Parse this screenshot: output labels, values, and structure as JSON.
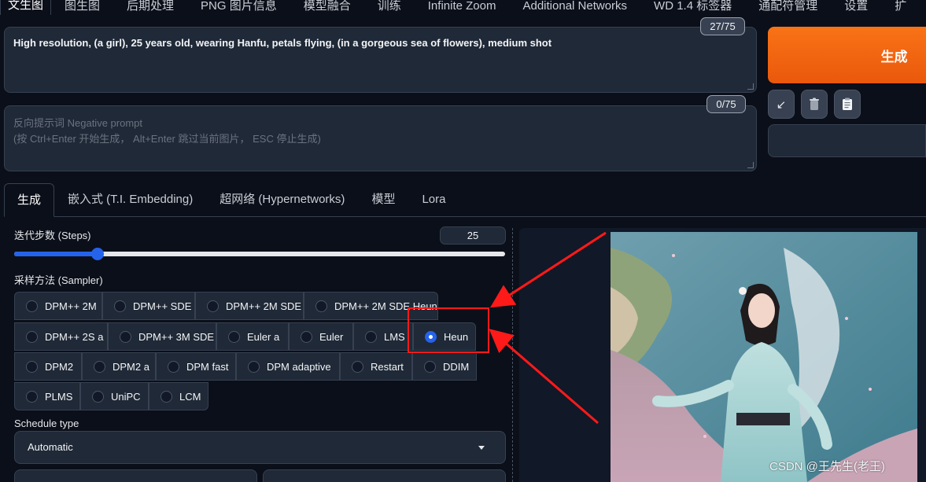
{
  "top_tabs": [
    {
      "label": "文生图",
      "active": true
    },
    {
      "label": "图生图"
    },
    {
      "label": "后期处理"
    },
    {
      "label": "PNG 图片信息"
    },
    {
      "label": "模型融合"
    },
    {
      "label": "训练"
    },
    {
      "label": "Infinite Zoom"
    },
    {
      "label": "Additional Networks"
    },
    {
      "label": "WD 1.4 标签器"
    },
    {
      "label": "通配符管理"
    },
    {
      "label": "设置"
    },
    {
      "label": "扩"
    }
  ],
  "prompt": {
    "text": "High resolution, (a girl), 25 years old, wearing Hanfu, petals flying, (in a gorgeous sea of flowers), medium shot",
    "counter": "27/75"
  },
  "negative": {
    "placeholder_line1": "反向提示词 Negative prompt",
    "placeholder_line2": "(按 Ctrl+Enter 开始生成， Alt+Enter 跳过当前图片， ESC 停止生成)",
    "counter": "0/75"
  },
  "generate_label": "生成",
  "tools": {
    "apply_icon": "↙",
    "trash_icon": "🗑",
    "clipboard_icon": "📋"
  },
  "sub_tabs": [
    {
      "label": "生成",
      "active": true
    },
    {
      "label": "嵌入式 (T.I. Embedding)"
    },
    {
      "label": "超网络 (Hypernetworks)"
    },
    {
      "label": "模型"
    },
    {
      "label": "Lora"
    }
  ],
  "steps": {
    "label": "迭代步数 (Steps)",
    "value": "25",
    "fraction": 0.17
  },
  "sampler": {
    "label": "采样方法 (Sampler)",
    "selected": "Heun",
    "options": [
      "DPM++ 2M",
      "DPM++ SDE",
      "DPM++ 2M SDE",
      "DPM++ 2M SDE Heun",
      "DPM++ 2S a",
      "DPM++ 3M SDE",
      "Euler a",
      "Euler",
      "LMS",
      "Heun",
      "DPM2",
      "DPM2 a",
      "DPM fast",
      "DPM adaptive",
      "Restart",
      "DDIM",
      "PLMS",
      "UniPC",
      "LCM"
    ]
  },
  "schedule": {
    "label": "Schedule type",
    "value": "Automatic"
  },
  "watermark": "CSDN @王先生(老王)",
  "colors": {
    "accent": "#2563eb",
    "generate": "#f97316",
    "highlight": "#ff1a1a"
  }
}
